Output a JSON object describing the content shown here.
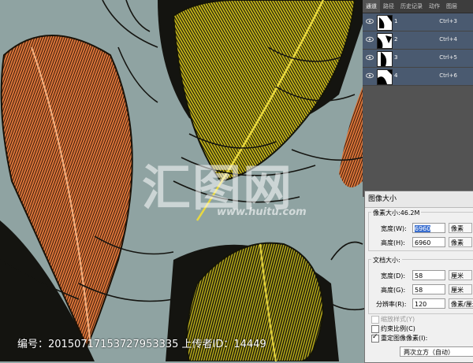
{
  "layers_panel": {
    "tabs": [
      "通道",
      "路径",
      "历史记录",
      "动作",
      "图层"
    ],
    "active_tab": 0,
    "channels": [
      {
        "name": "1",
        "shortcut": "Ctrl+3"
      },
      {
        "name": "2",
        "shortcut": "Ctrl+4"
      },
      {
        "name": "3",
        "shortcut": "Ctrl+5"
      },
      {
        "name": "4",
        "shortcut": "Ctrl+6"
      }
    ]
  },
  "dialog": {
    "title": "图像大小",
    "pixel_dims_label": "像素大小:46.2M",
    "width_label": "宽度(W):",
    "width_value": "6960",
    "width_unit": "像素",
    "height_label": "高度(H):",
    "height_value": "6960",
    "height_unit": "像素",
    "doc_size_label": "文档大小:",
    "doc_width_label": "宽度(D):",
    "doc_width_value": "58",
    "doc_width_unit": "厘米",
    "doc_height_label": "高度(G):",
    "doc_height_value": "58",
    "doc_height_unit": "厘米",
    "resolution_label": "分辨率(R):",
    "resolution_value": "120",
    "resolution_unit": "像素/厘米",
    "scale_styles_label": "缩放样式(Y)",
    "constrain_label": "约束比例(C)",
    "resample_label": "重定图像像素(I):",
    "resample_method": "两次立方（自动）"
  },
  "watermark": {
    "logo_text": "汇图网",
    "url_text": "www.huitu.com"
  },
  "caption": "编号：20150717153727953335 上传者ID：14449",
  "colors": {
    "background": "#8fa3a2",
    "feather_orange": "#d9743a",
    "feather_yellow": "#c9b81a",
    "feather_dark": "#1a1a12"
  }
}
